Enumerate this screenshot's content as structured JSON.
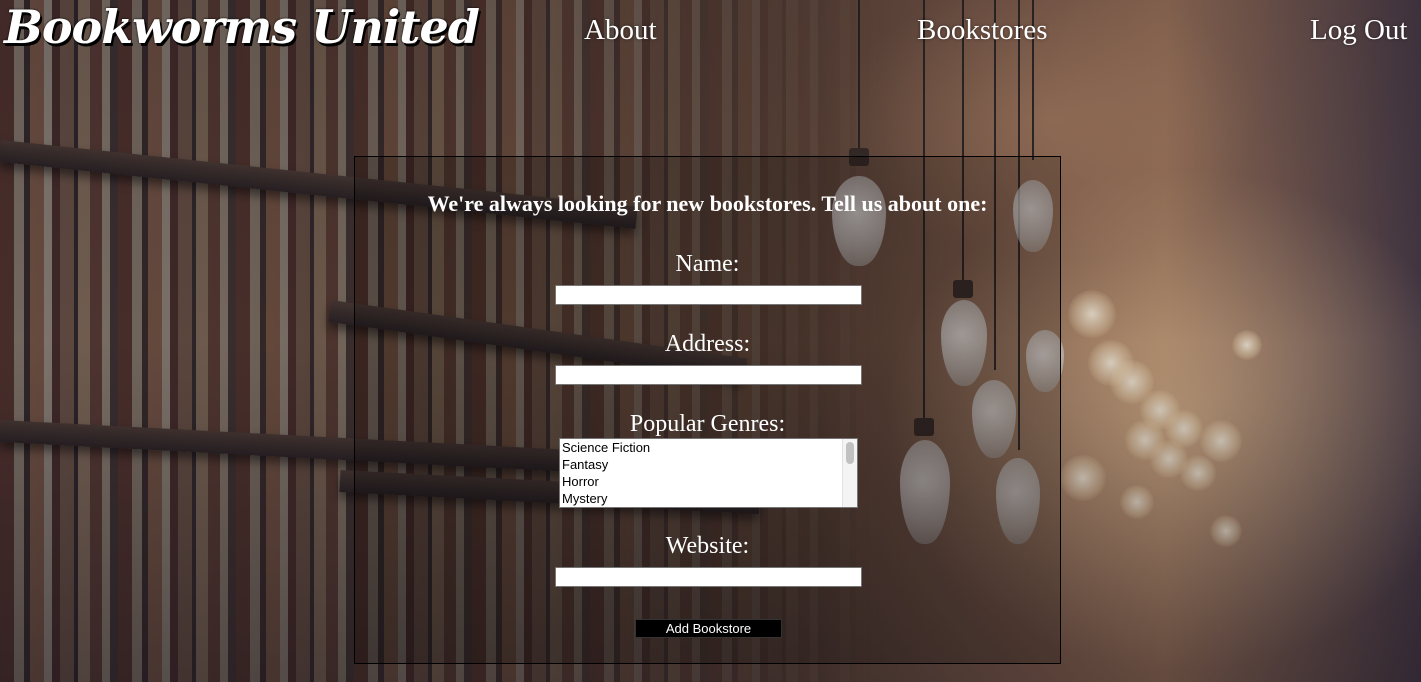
{
  "header": {
    "brand": "Bookworms United",
    "nav": {
      "about": "About",
      "bookstores": "Bookstores",
      "logout": "Log Out"
    }
  },
  "form": {
    "heading": "We're always looking for new bookstores. Tell us about one:",
    "name": {
      "label": "Name:",
      "value": ""
    },
    "address": {
      "label": "Address:",
      "value": ""
    },
    "genres": {
      "label": "Popular Genres:",
      "options": [
        "Science Fiction",
        "Fantasy",
        "Horror",
        "Mystery"
      ]
    },
    "website": {
      "label": "Website:",
      "value": ""
    },
    "submit_label": "Add Bookstore"
  }
}
